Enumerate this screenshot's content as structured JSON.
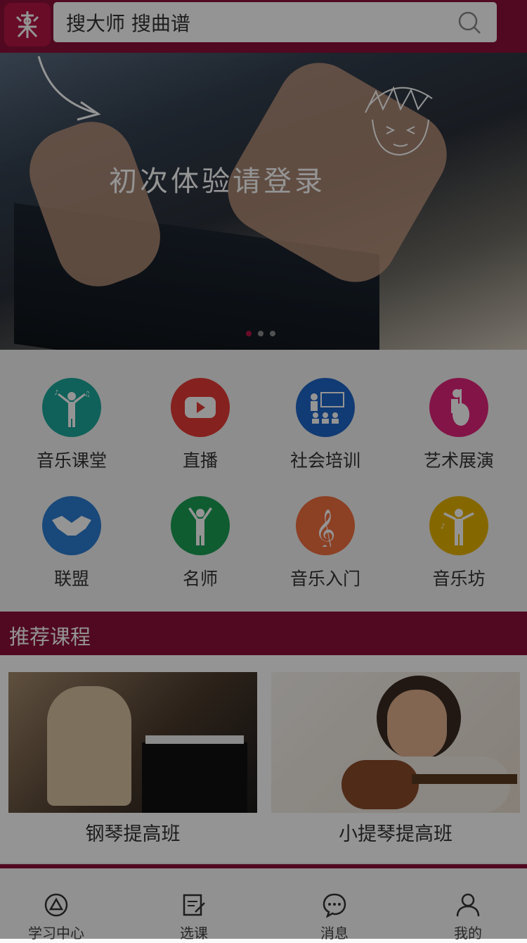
{
  "header": {
    "search_placeholder": "搜大师  搜曲谱"
  },
  "banner": {
    "text": "初次体验请登录"
  },
  "categories": [
    {
      "label": "音乐课堂",
      "color": "#1aa79b",
      "icon": "music-class-icon"
    },
    {
      "label": "直播",
      "color": "#e53935",
      "icon": "live-play-icon"
    },
    {
      "label": "社会培训",
      "color": "#1e66c8",
      "icon": "training-icon"
    },
    {
      "label": "艺术展演",
      "color": "#e2247a",
      "icon": "cello-icon"
    },
    {
      "label": "联盟",
      "color": "#2b7cd3",
      "icon": "handshake-icon"
    },
    {
      "label": "名师",
      "color": "#1a9f55",
      "icon": "conductor-icon"
    },
    {
      "label": "音乐入门",
      "color": "#f26e3f",
      "icon": "treble-clef-icon"
    },
    {
      "label": "音乐坊",
      "color": "#e6b100",
      "icon": "singer-icon"
    }
  ],
  "section": {
    "title": "推荐课程"
  },
  "courses": [
    {
      "label": "钢琴提高班"
    },
    {
      "label": "小提琴提高班"
    }
  ],
  "tabs": [
    {
      "label": "学习中心"
    },
    {
      "label": "选课"
    },
    {
      "label": "消息"
    },
    {
      "label": "我的"
    }
  ],
  "colors": {
    "brand": "#8a1038",
    "brand_light": "#b51645"
  }
}
